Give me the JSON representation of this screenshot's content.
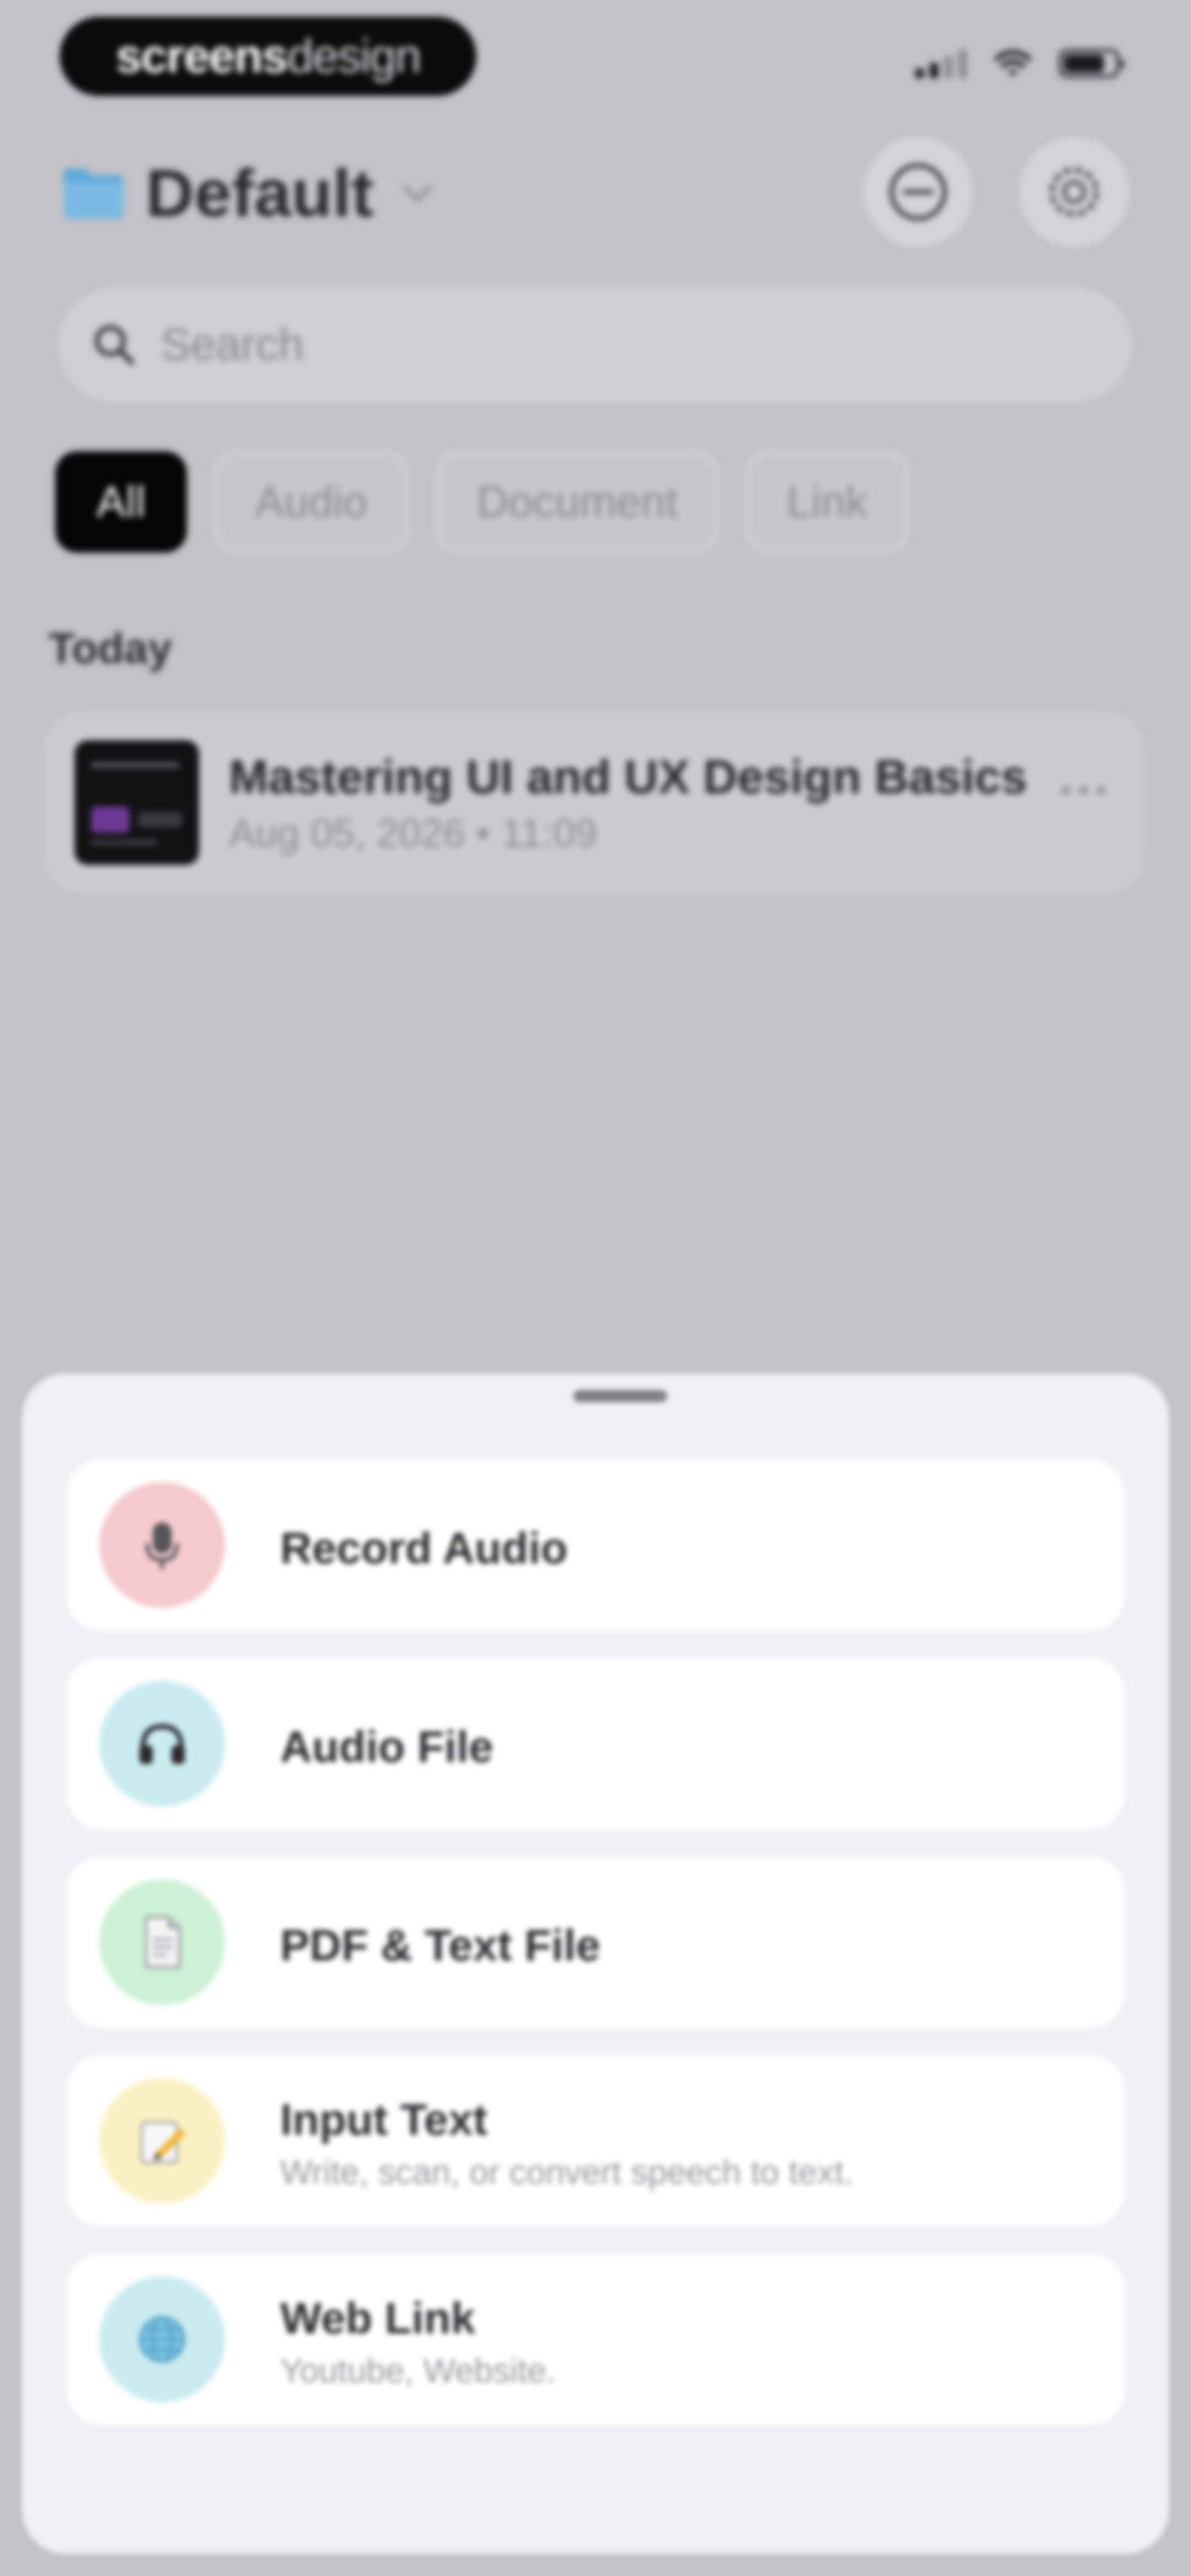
{
  "status_bar": {
    "watermark_bold": "screens",
    "watermark_light": "design"
  },
  "header": {
    "title": "Default",
    "icons": {
      "folder": "folder-icon",
      "chevron": "chevron-down-icon",
      "minus": "minus-circle-icon",
      "settings": "gear-icon"
    },
    "colors": {
      "folder": "#5fa8d9"
    }
  },
  "search": {
    "placeholder": "Search",
    "value": ""
  },
  "filters": {
    "items": [
      "All",
      "Audio",
      "Document",
      "Link"
    ],
    "selected": "All"
  },
  "section": {
    "label": "Today"
  },
  "recent_item": {
    "title": "Mastering UI and UX Design Basics",
    "date": "Aug 05, 2026",
    "time": "11:09",
    "meta": "Aug 05, 2026 • 11:09"
  },
  "sheet": {
    "options": [
      {
        "label": "Record Audio",
        "sub": "",
        "icon": "microphone-icon",
        "color": "#f5c9cd"
      },
      {
        "label": "Audio File",
        "sub": "",
        "icon": "headphones-icon",
        "color": "#c9ebf1"
      },
      {
        "label": "PDF & Text File",
        "sub": "",
        "icon": "document-icon",
        "color": "#cdf0d6"
      },
      {
        "label": "Input Text",
        "sub": "Write, scan, or convert speech to text.",
        "icon": "pencil-icon",
        "color": "#fbf0c3"
      },
      {
        "label": "Web Link",
        "sub": "Youtube, Website.",
        "icon": "globe-icon",
        "color": "#c9ebf1"
      }
    ]
  }
}
